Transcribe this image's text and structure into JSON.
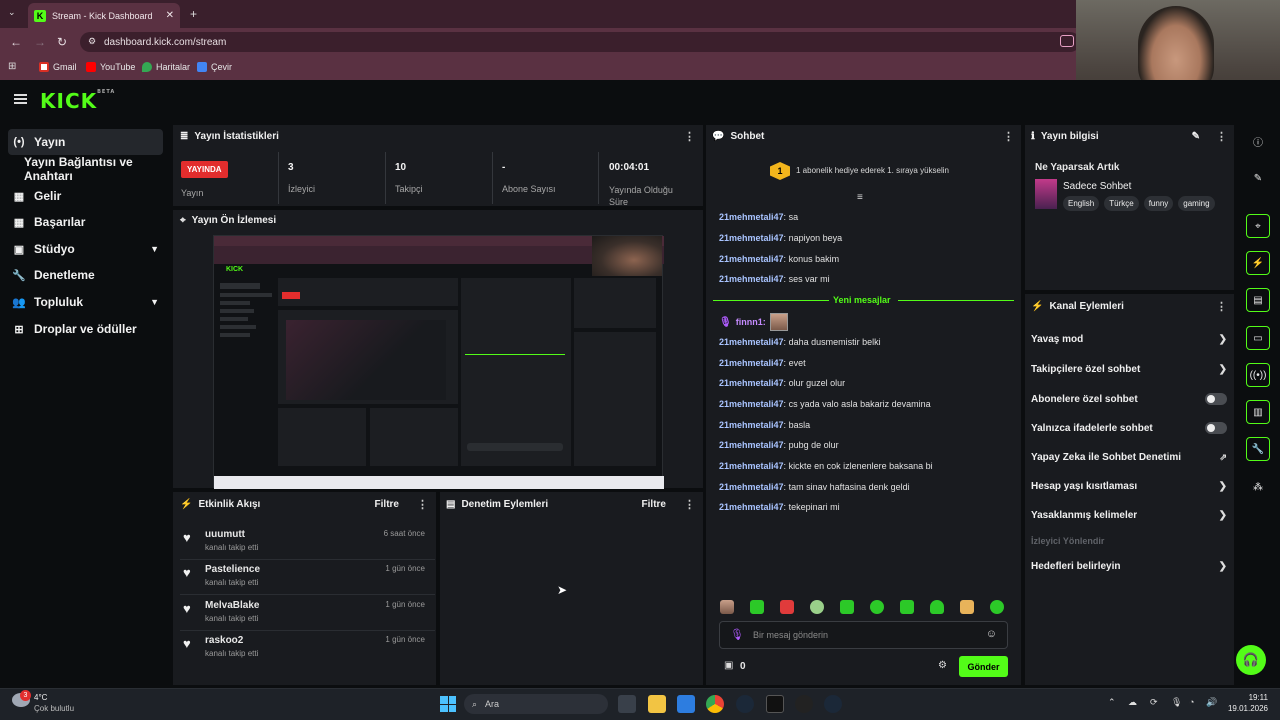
{
  "browser": {
    "tab_title": "Stream - Kick Dashboard",
    "tab_close": "✕",
    "new_tab": "+",
    "url": "dashboard.kick.com/stream",
    "bookmarks": [
      "Gmail",
      "YouTube",
      "Haritalar",
      "Çevir"
    ]
  },
  "header": {
    "logo": "KICK",
    "logo_sup": "BETA"
  },
  "sidebar": {
    "items": [
      {
        "label": "Yayın",
        "icon": "(•)"
      },
      {
        "label": "Yayın Bağlantısı ve Anahtarı",
        "icon": ""
      },
      {
        "label": "Gelir",
        "icon": "▦"
      },
      {
        "label": "Başarılar",
        "icon": "▦"
      },
      {
        "label": "Stüdyo",
        "icon": "▣"
      },
      {
        "label": "Denetleme",
        "icon": "🔧"
      },
      {
        "label": "Topluluk",
        "icon": "👥"
      },
      {
        "label": "Droplar ve ödüller",
        "icon": "⊞"
      }
    ]
  },
  "stats": {
    "title": "Yayın İstatistikleri",
    "live_badge": "YAYINDA",
    "live_label": "Yayın",
    "viewers_value": "3",
    "viewers_label": "İzleyici",
    "followers_value": "10",
    "followers_label": "Takipçi",
    "subs_value": "-",
    "subs_label": "Abone Sayısı",
    "uptime_value": "00:04:01",
    "uptime_label": "Yayında Olduğu Süre"
  },
  "preview": {
    "title": "Yayın Ön İzlemesi"
  },
  "activity": {
    "title": "Etkinlik Akışı",
    "filter": "Filtre",
    "items": [
      {
        "user": "uuumutt",
        "action": "kanalı takip etti",
        "time": "6 saat önce"
      },
      {
        "user": "Pastelience",
        "action": "kanalı takip etti",
        "time": "1 gün önce"
      },
      {
        "user": "MelvaBlake",
        "action": "kanalı takip etti",
        "time": "1 gün önce"
      },
      {
        "user": "raskoo2",
        "action": "kanalı takip etti",
        "time": "1 gün önce"
      }
    ]
  },
  "moderation": {
    "title": "Denetim Eylemleri",
    "filter": "Filtre"
  },
  "chat": {
    "title": "Sohbet",
    "gift_banner": "1 abonelik hediye ederek 1. sıraya yükselin",
    "gift_rank": "1",
    "new_messages": "Yeni mesajlar",
    "messages_before": [
      {
        "user": "21mehmetali47",
        "text": "sa"
      },
      {
        "user": "21mehmetali47",
        "text": "napiyon beya"
      },
      {
        "user": "21mehmetali47",
        "text": "konus bakim"
      },
      {
        "user": "21mehmetali47",
        "text": "ses var mi"
      }
    ],
    "host_user": "finnn1:",
    "messages_after": [
      {
        "user": "21mehmetali47",
        "text": "daha dusmemistir belki"
      },
      {
        "user": "21mehmetali47",
        "text": "evet"
      },
      {
        "user": "21mehmetali47",
        "text": "olur guzel olur"
      },
      {
        "user": "21mehmetali47",
        "text": "cs yada valo asla bakariz devamina"
      },
      {
        "user": "21mehmetali47",
        "text": "basla"
      },
      {
        "user": "21mehmetali47",
        "text": "pubg de olur"
      },
      {
        "user": "21mehmetali47",
        "text": "kickte en cok izlenenlere baksana bi"
      },
      {
        "user": "21mehmetali47",
        "text": "tam sinav haftasina denk geldi"
      },
      {
        "user": "21mehmetali47",
        "text": "tekepinari mi"
      }
    ],
    "input_placeholder": "Bir mesaj gönderin",
    "points": "0",
    "send": "Gönder"
  },
  "stream_info": {
    "title": "Yayın bilgisi",
    "stream_title": "Ne Yaparsak Artık",
    "category": "Sadece Sohbet",
    "tags": [
      "English",
      "Türkçe",
      "funny",
      "gaming"
    ]
  },
  "channel_actions": {
    "title": "Kanal Eylemleri",
    "items": [
      {
        "label": "Yavaş mod",
        "kind": "chevron"
      },
      {
        "label": "Takipçilere özel sohbet",
        "kind": "chevron"
      },
      {
        "label": "Abonelere özel sohbet",
        "kind": "toggle"
      },
      {
        "label": "Yalnızca ifadelerle sohbet",
        "kind": "toggle"
      },
      {
        "label": "Yapay Zeka ile Sohbet Denetimi",
        "kind": "external"
      },
      {
        "label": "Hesap yaşı kısıtlaması",
        "kind": "chevron"
      },
      {
        "label": "Yasaklanmış kelimeler",
        "kind": "chevron"
      },
      {
        "label": "İzleyici Yönlendir",
        "kind": "disabled"
      },
      {
        "label": "Hedefleri belirleyin",
        "kind": "chevron"
      }
    ]
  },
  "taskbar": {
    "weather_temp": "4°C",
    "weather_desc": "Çok bulutlu",
    "weather_badge": "3",
    "search": "Ara",
    "time": "19:11",
    "date": "19.01.2026"
  },
  "colors": {
    "accent": "#53fc18",
    "live": "#e22d2d",
    "panel": "#191b1f",
    "bg": "#0b0d0f"
  }
}
